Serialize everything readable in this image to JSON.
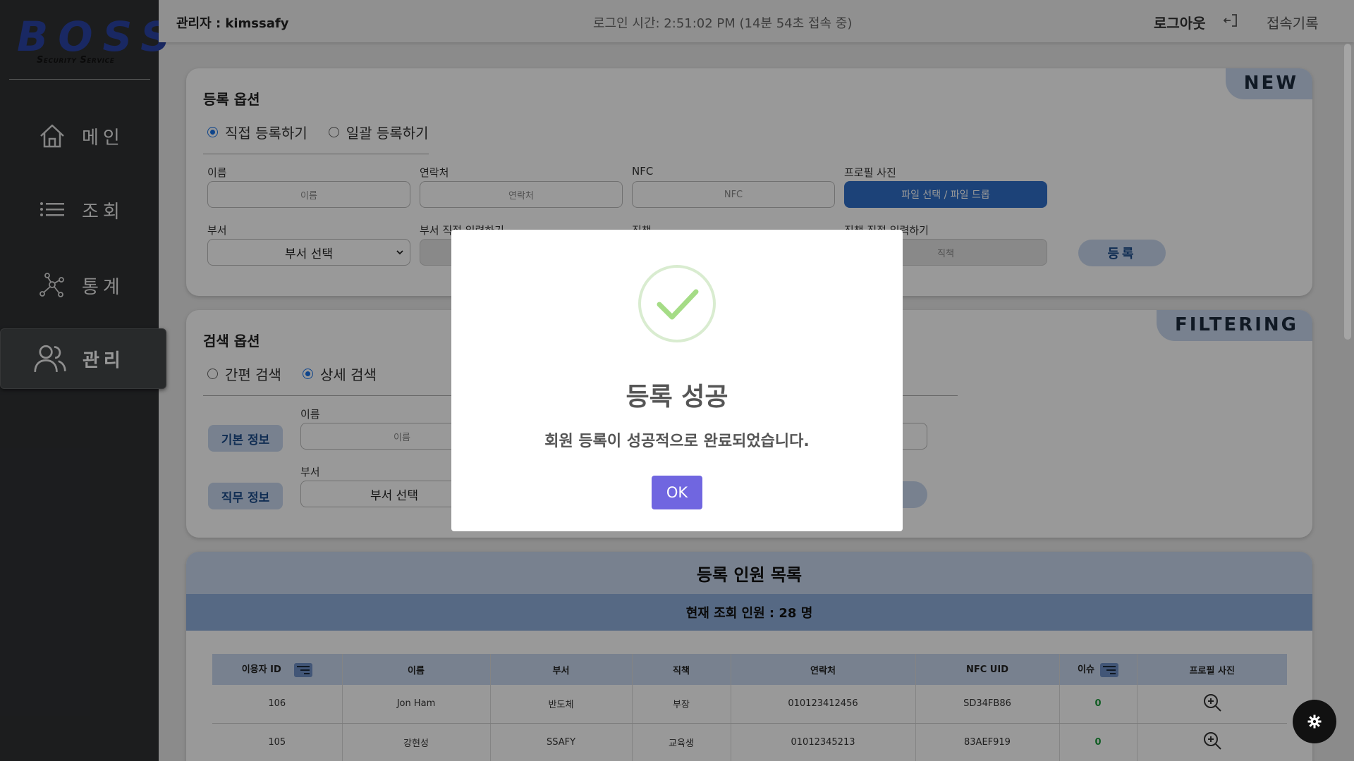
{
  "app": {
    "logo_text": "BOSS",
    "logo_sub": "Security Service"
  },
  "sidebar": {
    "items": [
      {
        "label": "메인",
        "icon": "home-icon"
      },
      {
        "label": "조회",
        "icon": "list-icon"
      },
      {
        "label": "통계",
        "icon": "network-icon"
      },
      {
        "label": "관리",
        "icon": "users-icon",
        "active": true
      }
    ]
  },
  "header": {
    "admin": "관리자 : kimssafy",
    "login_time": "로그인 시간: 2:51:02 PM (14분 54초 접속 중)",
    "logout": "로그아웃",
    "access_log": "접속기록"
  },
  "register": {
    "tag": "NEW",
    "title": "등록 옵션",
    "radio_direct": "직접 등록하기",
    "radio_bulk": "일괄 등록하기",
    "name_label": "이름",
    "name_placeholder": "이름",
    "phone_label": "연락처",
    "phone_placeholder": "연락처",
    "nfc_label": "NFC",
    "nfc_placeholder": "NFC",
    "photo_label": "프로필 사진",
    "photo_button": "파일 선택 / 파일 드롭",
    "dept_label": "부서",
    "dept_select": "부서 선택",
    "dept_direct_label": "부서 직접 입력하기",
    "position_label": "직책",
    "position_direct_label": "직책 직접 입력하기",
    "position_placeholder": "직책",
    "submit": "등록"
  },
  "search": {
    "tag": "FILTERING",
    "title": "검색 옵션",
    "radio_simple": "간편 검색",
    "radio_detail": "상세 검색",
    "basic_info": "기본 정보",
    "job_info": "직무 정보",
    "name_label": "이름",
    "name_placeholder": "이름",
    "dept_label": "부서",
    "dept_select": "부서 선택"
  },
  "list": {
    "title": "등록 인원 목록",
    "count_text": "현재 조회 인원 : 28 명",
    "columns": [
      "이용자 ID",
      "이름",
      "부서",
      "직책",
      "연락처",
      "NFC UID",
      "이슈",
      "프로필 사진"
    ],
    "rows": [
      {
        "id": "106",
        "name": "Jon Ham",
        "dept": "반도체",
        "position": "부장",
        "phone": "010123412456",
        "nfc": "SD34FB86",
        "issue": "0"
      },
      {
        "id": "105",
        "name": "강현성",
        "dept": "SSAFY",
        "position": "교육생",
        "phone": "01012345213",
        "nfc": "83AEF919",
        "issue": "0"
      }
    ]
  },
  "modal": {
    "title": "등록 성공",
    "message": "회원 등록이 성공적으로 완료되었습니다.",
    "ok": "OK"
  },
  "colors": {
    "accent_blue": "#2f6fc8",
    "light_blue": "#c9d8ee",
    "ok_button": "#7066e0",
    "success_green": "#a5dc86"
  }
}
